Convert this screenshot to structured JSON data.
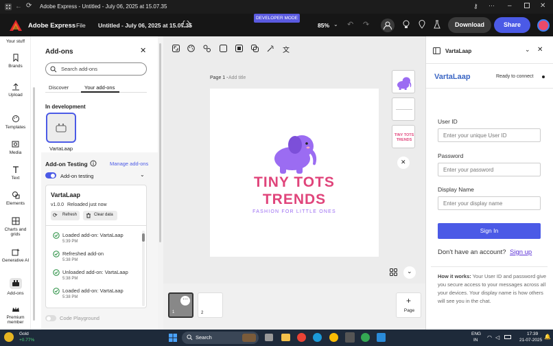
{
  "window": {
    "title": "Adobe Express - Untitled - July 06, 2025 at 15.07.35"
  },
  "appbar": {
    "brand": "Adobe Express",
    "file": "File",
    "doc_title": "Untitled - July 06, 2025 at 15.07.35",
    "dev_mode": "DEVELOPER MODE",
    "zoom": "85%",
    "download": "Download",
    "share": "Share"
  },
  "rail": {
    "items": [
      {
        "label": "Your stuff"
      },
      {
        "label": "Brands"
      },
      {
        "label": "Upload"
      },
      {
        "label": "Templates"
      },
      {
        "label": "Media"
      },
      {
        "label": "Text"
      },
      {
        "label": "Elements"
      },
      {
        "label": "Charts and grids"
      },
      {
        "label": "Generative AI"
      },
      {
        "label": "Add-ons"
      },
      {
        "label": "Premium member"
      }
    ]
  },
  "addons": {
    "title": "Add-ons",
    "search_placeholder": "Search add-ons",
    "tabs": [
      "Discover",
      "Your add-ons"
    ],
    "in_dev": "In development",
    "addon_name": "VartaLaap",
    "testing_title": "Add-on Testing",
    "manage": "Manage add-ons",
    "testing_toggle": "Add-on testing",
    "card": {
      "name": "VartaLaap",
      "version": "v1.0.0",
      "reloaded": "Reloaded just now",
      "refresh": "Refresh",
      "clear": "Clear data"
    },
    "log": [
      {
        "msg": "Loaded add-on: VartaLaap",
        "time": "5:39 PM"
      },
      {
        "msg": "Refreshed add-on",
        "time": "5:38 PM"
      },
      {
        "msg": "Unloaded add-on: VartaLaap",
        "time": "5:38 PM"
      },
      {
        "msg": "Loaded add-on: VartaLaap",
        "time": "5:38 PM"
      }
    ],
    "playground": "Code Playground"
  },
  "canvas": {
    "page_label": "Page 1 - ",
    "add_title": "Add title",
    "logo_line1": "TINY TOTS",
    "logo_line2": "TRENDS",
    "tagline": "FASHION FOR LITTLE ONES",
    "thumb_text": "TINY TOTS TRENDS",
    "pages": [
      "1",
      "2"
    ],
    "add_page": "Page"
  },
  "right": {
    "header": "VartaLaap",
    "app_title": "VartaLaap",
    "status": "Ready to connect",
    "user_id_label": "User ID",
    "user_id_ph": "Enter your unique User ID",
    "password_label": "Password",
    "password_ph": "Enter your password",
    "display_label": "Display Name",
    "display_ph": "Enter your display name",
    "signin": "Sign In",
    "no_account": "Don't have an account?",
    "signup": "Sign up",
    "how_bold": "How it works:",
    "how_text": " Your User ID and password give you secure access to your messages across all your devices. Your display name is how others will see you in the chat."
  },
  "taskbar": {
    "gold": "Gold",
    "gold_change": "+0.77%",
    "search": "Search",
    "lang1": "ENG",
    "lang2": "IN",
    "time": "17:39",
    "date": "21-07-2025"
  },
  "colors": {
    "accent": "#4b5ae6",
    "brand_pink": "#e0457b",
    "purple": "#8a5cf0",
    "sidebar_bg": "#161616"
  }
}
